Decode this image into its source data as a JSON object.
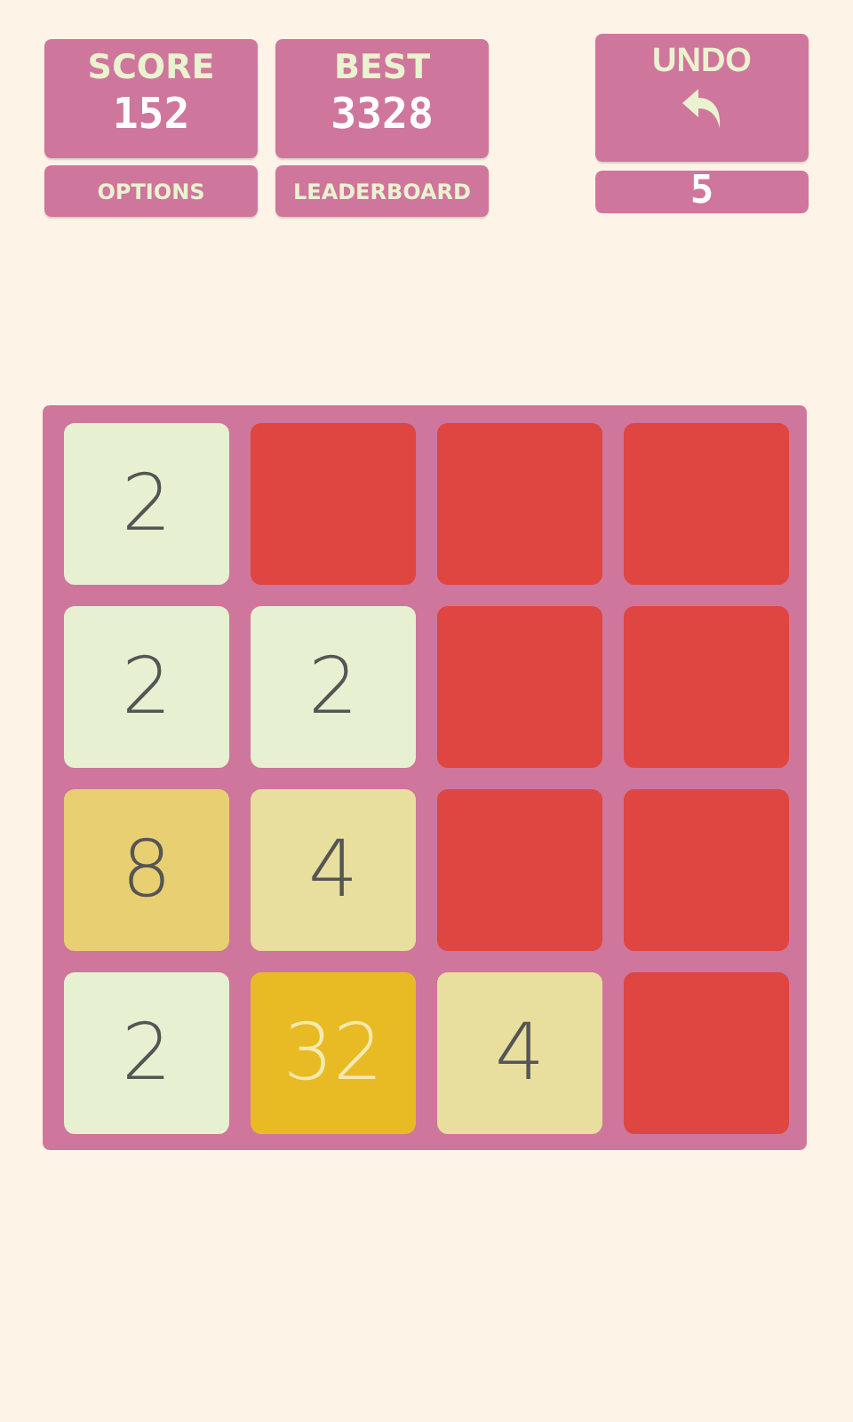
{
  "score": {
    "label": "SCORE",
    "value": "152"
  },
  "best": {
    "label": "BEST",
    "value": "3328"
  },
  "options_button": "OPTIONS",
  "leaderboard_button": "LEADERBOARD",
  "undo": {
    "label": "UNDO",
    "count": "5"
  },
  "board": [
    [
      {
        "kind": "tile",
        "value": "2"
      },
      {
        "kind": "empty"
      },
      {
        "kind": "empty"
      },
      {
        "kind": "empty"
      }
    ],
    [
      {
        "kind": "tile",
        "value": "2"
      },
      {
        "kind": "tile",
        "value": "2"
      },
      {
        "kind": "empty"
      },
      {
        "kind": "empty"
      }
    ],
    [
      {
        "kind": "tile",
        "value": "8"
      },
      {
        "kind": "tile",
        "value": "4"
      },
      {
        "kind": "empty"
      },
      {
        "kind": "empty"
      }
    ],
    [
      {
        "kind": "tile",
        "value": "2"
      },
      {
        "kind": "tile",
        "value": "32"
      },
      {
        "kind": "tile",
        "value": "4"
      },
      {
        "kind": "empty"
      }
    ]
  ]
}
